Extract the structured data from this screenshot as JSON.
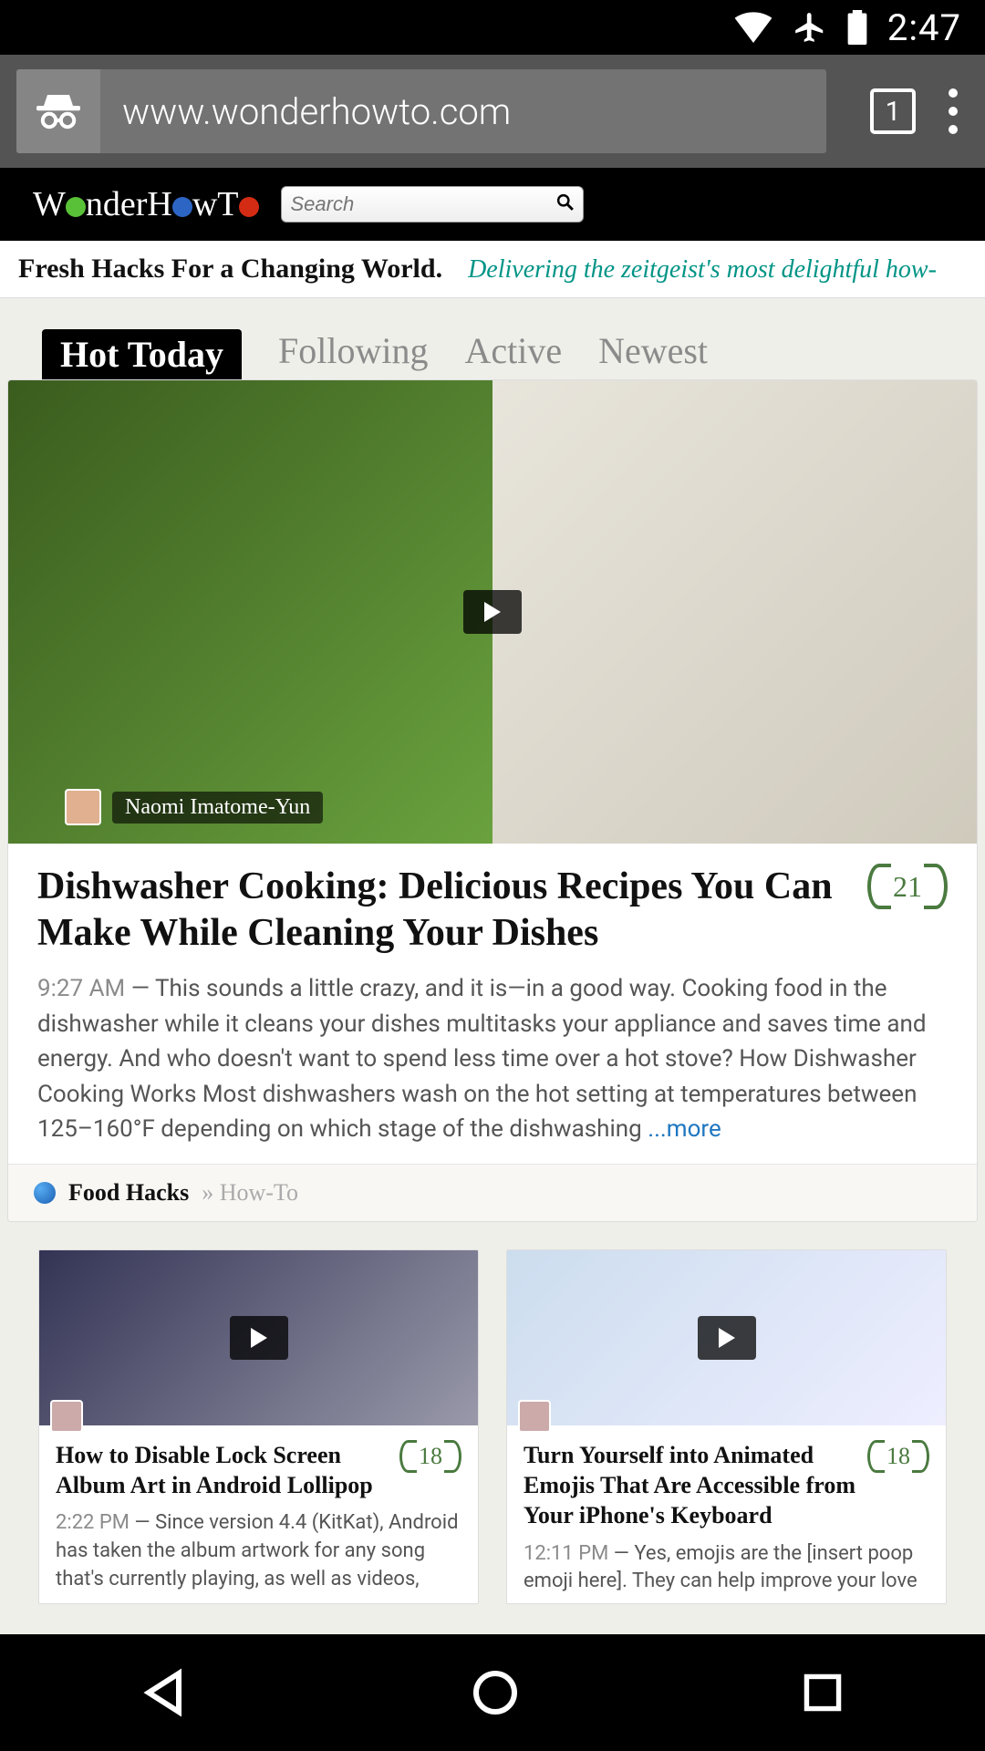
{
  "status_bar": {
    "time": "2:47"
  },
  "browser_bar": {
    "url": "www.wonderhowto.com",
    "tab_count": "1"
  },
  "site_header": {
    "logo_prefix": "W",
    "logo_text1": "nderH",
    "logo_text2": "wT",
    "search_placeholder": "Search"
  },
  "tagline": {
    "bold": "Fresh Hacks For a Changing World.",
    "teal": "Delivering the zeitgeist's most delightful how-"
  },
  "tabs": [
    "Hot Today",
    "Following",
    "Active",
    "Newest"
  ],
  "featured": {
    "author": "Naomi Imatome-Yun",
    "badge": "21",
    "title": "Dishwasher Cooking: Delicious Recipes You Can Make While Cleaning Your Dishes",
    "time": "9:27 AM",
    "sep": " — ",
    "excerpt": "This sounds a little crazy, and it is—in a good way. Cooking food in the dishwasher while it cleans your dishes multitasks your appliance and saves time and energy. And who doesn't want to spend less time over a hot stove? How Dishwasher Cooking Works Most dishwashers wash on the hot setting at temperatures between 125–160°F depending on which stage of the dishwashing ",
    "more": "...more",
    "category": "Food Hacks",
    "crumb_sep": " » ",
    "crumb": "How-To"
  },
  "cards": [
    {
      "badge": "18",
      "title": "How to Disable Lock Screen Album Art in Android Lollipop",
      "time": "2:22 PM",
      "sep": " — ",
      "excerpt": "Since version 4.4 (KitKat), Android has taken the album artwork for any song that's currently playing, as well as videos,"
    },
    {
      "badge": "18",
      "title": "Turn Yourself into Animated Emojis That Are Accessible from Your iPhone's Keyboard",
      "time": "12:11 PM",
      "sep": " — ",
      "excerpt": "Yes, emojis are the [insert poop emoji here]. They can help improve your love"
    }
  ]
}
